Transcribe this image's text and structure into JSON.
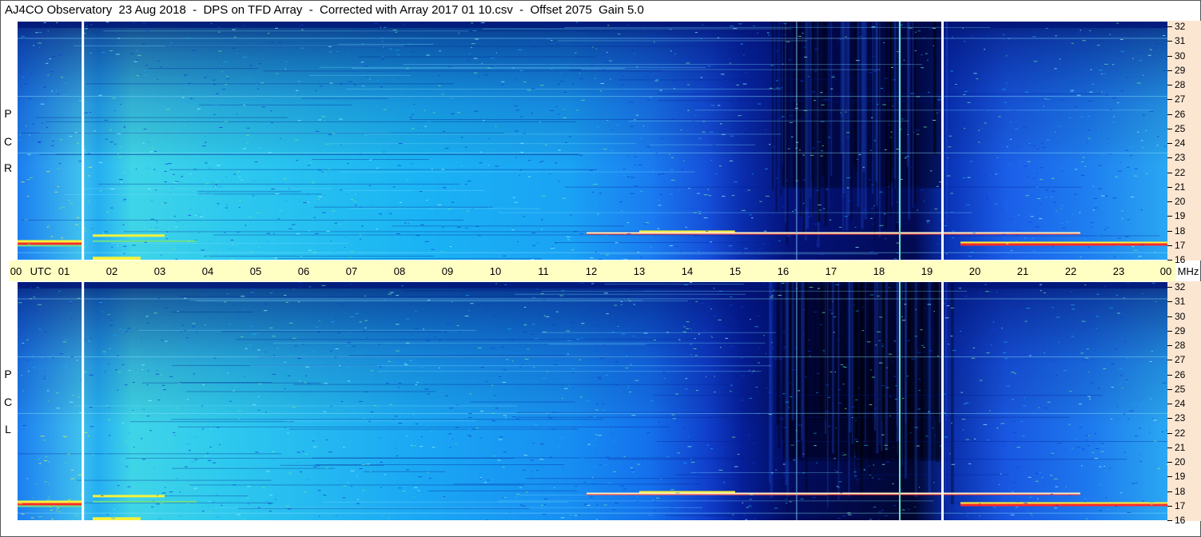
{
  "title": "AJ4CO Observatory  23 Aug 2018  -  DPS on TFD Array  -  Corrected with Array 2017 01 10.csv  -  Offset 2075  Gain 5.0",
  "colors": {
    "timebar_bg": "#ffffc4",
    "axis_bg": "#fbe6d2",
    "dark": "#000010",
    "deep_blue": "#0a1fb0",
    "blue": "#1a5cf0",
    "cyan": "#17c6f5",
    "green": "#6fe08a",
    "yellow": "#f7f13a",
    "red": "#ff2a2a"
  },
  "chart_data": {
    "type": "heatmap",
    "description_panels": [
      "RCP",
      "LCP"
    ],
    "panels": [
      {
        "name": "R C P",
        "letters": [
          "R",
          "C",
          "P"
        ]
      },
      {
        "name": "L C P",
        "letters": [
          "L",
          "C",
          "P"
        ]
      }
    ],
    "x_axis": {
      "unit_label": "UTC",
      "ticks": [
        "00",
        "01",
        "02",
        "03",
        "04",
        "05",
        "06",
        "07",
        "08",
        "09",
        "10",
        "11",
        "12",
        "13",
        "14",
        "15",
        "16",
        "17",
        "18",
        "19",
        "20",
        "21",
        "22",
        "23",
        "00"
      ],
      "range_hours": [
        0,
        24
      ]
    },
    "y_axis": {
      "unit_label": "MHz",
      "ticks": [
        "16",
        "17",
        "18",
        "19",
        "20",
        "21",
        "22",
        "23",
        "24",
        "25",
        "26",
        "27",
        "28",
        "29",
        "30",
        "31",
        "32"
      ],
      "range_mhz": [
        16,
        32
      ]
    },
    "white_markers_utc": [
      1.42,
      19.35
    ],
    "features": {
      "night_dark_region_utc": [
        15.0,
        19.3
      ],
      "bright_carrier_mhz": [
        17.05,
        17.8
      ],
      "vertical_lines_utc": [
        16.6,
        18.75
      ]
    }
  }
}
